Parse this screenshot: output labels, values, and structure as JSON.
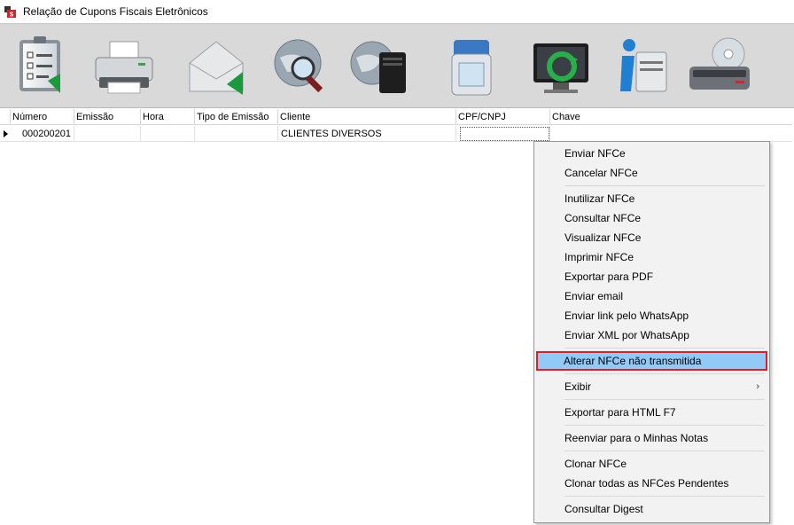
{
  "window": {
    "title": "Relação de Cupons Fiscais Eletrônicos"
  },
  "toolbar": {
    "buttons": [
      {
        "name": "checklist-icon"
      },
      {
        "name": "printer-icon"
      },
      {
        "name": "envelope-icon"
      },
      {
        "name": "globe-search-icon"
      },
      {
        "name": "globe-server-icon"
      },
      {
        "name": "water-filter-icon"
      },
      {
        "name": "monitor-refresh-icon"
      },
      {
        "name": "info-clipboard-icon"
      },
      {
        "name": "disc-drive-icon"
      }
    ]
  },
  "grid": {
    "columns": [
      "Número",
      "Emissão",
      "Hora",
      "Tipo de Emissão",
      "Cliente",
      "CPF/CNPJ",
      "Chave"
    ],
    "rows": [
      {
        "numero": "000200201",
        "emissao": "",
        "hora": "",
        "tipo": "",
        "cliente": "CLIENTES DIVERSOS",
        "cpf": "",
        "chave": ""
      }
    ]
  },
  "context_menu": {
    "items": [
      "Enviar NFCe",
      "Cancelar NFCe",
      "Inutilizar NFCe",
      "Consultar NFCe",
      "Visualizar NFCe",
      "Imprimir NFCe",
      "Exportar para PDF",
      "Enviar email",
      "Enviar link pelo WhatsApp",
      "Enviar XML por WhatsApp",
      "Alterar NFCe não transmitida",
      "Exibir",
      "Exportar para HTML  F7",
      "Reenviar para o Minhas Notas",
      "Clonar NFCe",
      "Clonar todas as NFCes Pendentes",
      "Consultar Digest"
    ],
    "submenu_arrow": "›"
  },
  "colors": {
    "highlight": "#91c9f7",
    "highlight_border": "#e31b23",
    "toolbar_bg": "#d9d9d9"
  }
}
